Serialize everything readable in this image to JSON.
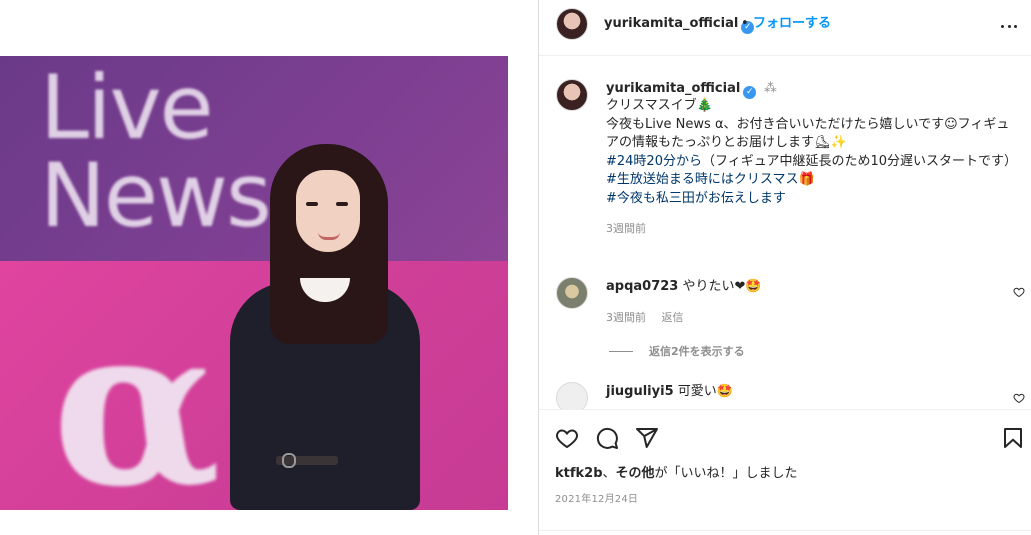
{
  "post": {
    "username": "yurikamita_official",
    "follow_label": "フォローする",
    "separator": "•"
  },
  "caption": {
    "username": "yurikamita_official",
    "badge_extra": "⁂",
    "lines": [
      "クリスマスイブ🎄",
      "今夜もLive News α、お付き合いいただけたら嬉しいです☺︎フィギュアの情報もたっぷりとお届けします⛸✨"
    ],
    "tag1": "#24時20分から",
    "tag1_rest": "（フィギュア中継延長のため10分遅いスタートです）",
    "tag2": "#生放送始まる時にはクリスマス🎁",
    "tag3": "#今夜も私三田がお伝えします",
    "time": "3週間前"
  },
  "comments": [
    {
      "username": "apqa0723",
      "text": "やりたい❤🤩",
      "time": "3週間前",
      "reply_label": "返信"
    },
    {
      "username": "jiuguliyi5",
      "text": "可愛い🤩"
    }
  ],
  "view_replies_label": "返信2件を表示する",
  "likes": {
    "user": "ktfk2b",
    "middle": "、",
    "others": "その他",
    "suffix": "が「いいね！」しました"
  },
  "date": "2021年12月24日",
  "photo": {
    "overlay_line1": "Live",
    "overlay_line2": "News",
    "overlay_alpha": "α"
  },
  "icons": {
    "more": "more-icon",
    "like": "heart-icon",
    "comment": "comment-icon",
    "share": "share-icon",
    "save": "bookmark-icon"
  },
  "colors": {
    "link": "#0095f6",
    "hashtag": "#00376b",
    "muted": "#8e8e8e"
  }
}
